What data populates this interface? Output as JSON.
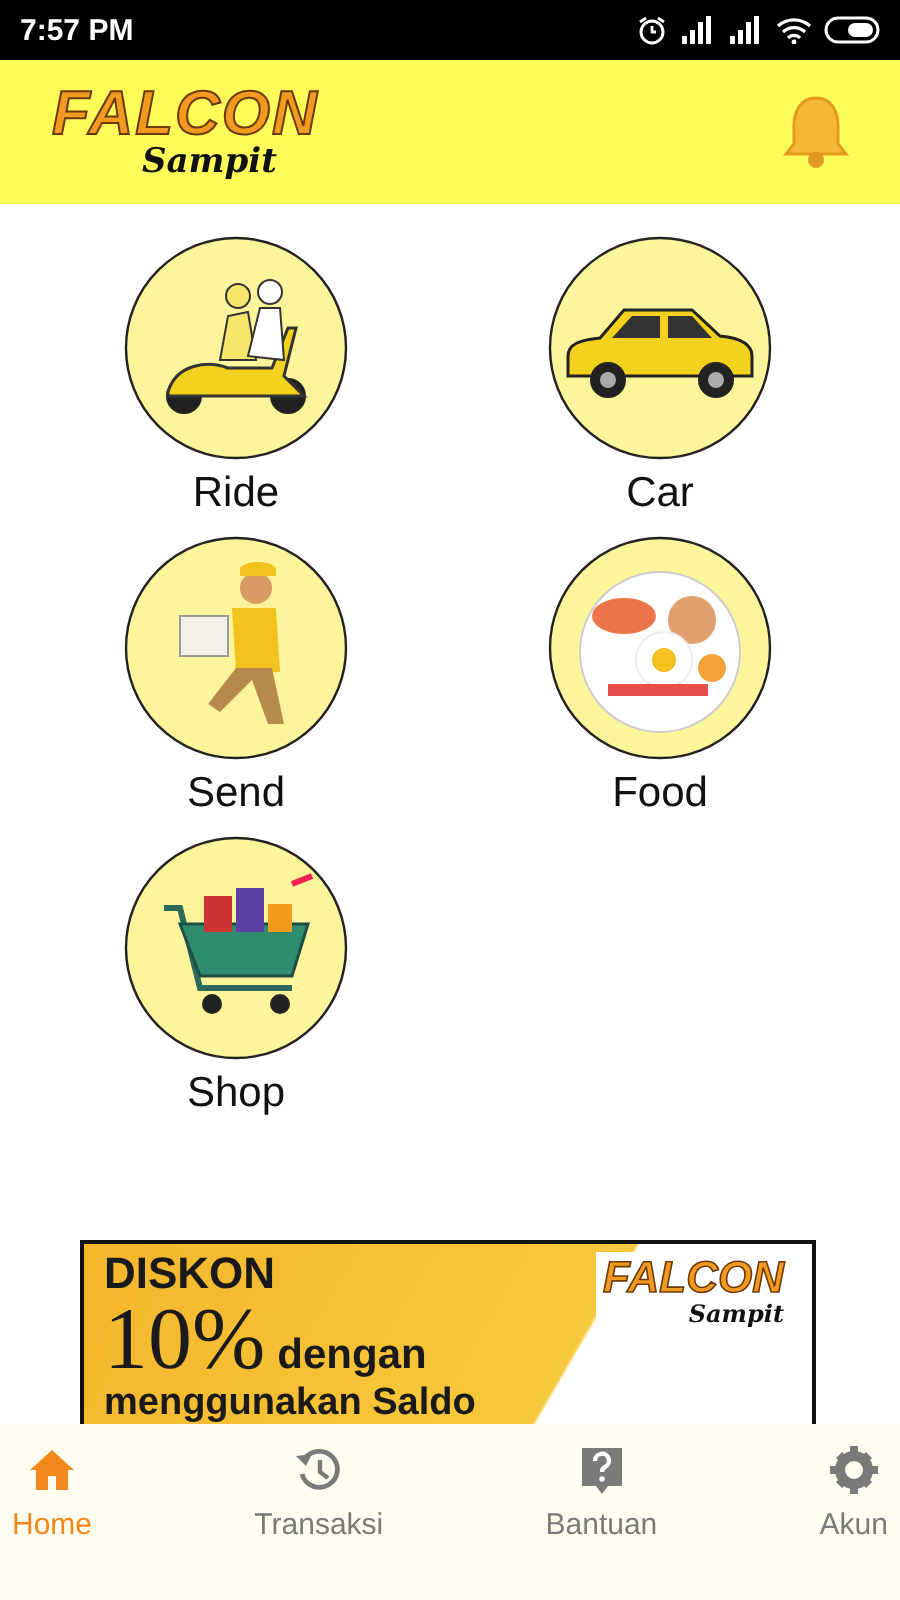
{
  "status_bar": {
    "time": "7:57 PM"
  },
  "header": {
    "logo_title": "FALCON",
    "logo_subtitle": "Sampit"
  },
  "services": [
    {
      "kind": "ride",
      "label": "Ride"
    },
    {
      "kind": "car",
      "label": "Car"
    },
    {
      "kind": "send",
      "label": "Send"
    },
    {
      "kind": "food",
      "label": "Food"
    },
    {
      "kind": "shop",
      "label": "Shop"
    }
  ],
  "banner": {
    "headline": "DISKON",
    "amount": "10%",
    "connector": "dengan",
    "tail": "menggunakan Saldo",
    "logo_title": "FALCON",
    "logo_subtitle": "Sampit"
  },
  "bottom_nav": [
    {
      "kind": "home",
      "label": "Home",
      "selected": true
    },
    {
      "kind": "history",
      "label": "Transaksi",
      "selected": false
    },
    {
      "kind": "help",
      "label": "Bantuan",
      "selected": false
    },
    {
      "kind": "settings",
      "label": "Akun",
      "selected": false
    }
  ]
}
